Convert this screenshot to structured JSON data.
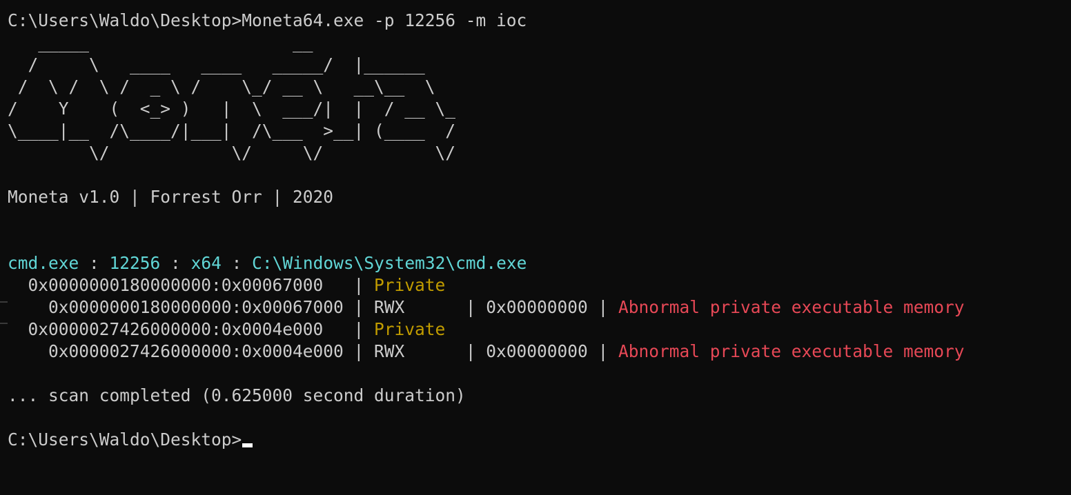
{
  "colors": {
    "background": "#0c0c0c",
    "default_text": "#cccccc",
    "cyan": "#61d6d6",
    "yellow": "#c19c00",
    "red": "#e74856",
    "cursor": "#ffffff"
  },
  "terminal": {
    "lines": [
      {
        "type": "command",
        "segments": [
          {
            "text": "C:\\Users\\Waldo\\Desktop>Moneta64.exe -p 12256 -m ioc",
            "color": "default"
          }
        ]
      },
      {
        "type": "banner",
        "segments": [
          {
            "text": "   _____                    __",
            "color": "default"
          }
        ]
      },
      {
        "type": "banner",
        "segments": [
          {
            "text": "  /     \\   ____   ____   _____/  |______",
            "color": "default"
          }
        ]
      },
      {
        "type": "banner",
        "segments": [
          {
            "text": " /  \\ /  \\ /  _ \\ /    \\_/ __ \\   __\\__  \\",
            "color": "default"
          }
        ]
      },
      {
        "type": "banner",
        "segments": [
          {
            "text": "/    Y    (  <_> )   |  \\  ___/|  |  / __ \\_",
            "color": "default"
          }
        ]
      },
      {
        "type": "banner",
        "segments": [
          {
            "text": "\\____|__  /\\____/|___|  /\\___  >__| (____  /",
            "color": "default"
          }
        ]
      },
      {
        "type": "banner",
        "segments": [
          {
            "text": "        \\/            \\/     \\/           \\/",
            "color": "default"
          }
        ]
      },
      {
        "type": "blank",
        "segments": []
      },
      {
        "type": "version",
        "segments": [
          {
            "text": "Moneta v1.0 | Forrest Orr | 2020",
            "color": "default"
          }
        ]
      },
      {
        "type": "blank",
        "segments": []
      },
      {
        "type": "blank",
        "segments": []
      },
      {
        "type": "process-header",
        "segments": [
          {
            "text": "cmd.exe",
            "color": "cyan"
          },
          {
            "text": " : ",
            "color": "default"
          },
          {
            "text": "12256",
            "color": "cyan"
          },
          {
            "text": " : ",
            "color": "default"
          },
          {
            "text": "x64",
            "color": "cyan"
          },
          {
            "text": " : ",
            "color": "default"
          },
          {
            "text": "C:\\Windows\\System32\\cmd.exe",
            "color": "cyan"
          }
        ]
      },
      {
        "type": "region",
        "segments": [
          {
            "text": "  0x0000000180000000:0x00067000   | ",
            "color": "default"
          },
          {
            "text": "Private",
            "color": "yellow"
          }
        ]
      },
      {
        "type": "subregion",
        "segments": [
          {
            "text": "    0x0000000180000000:0x00067000 | RWX      | 0x00000000 | ",
            "color": "default"
          },
          {
            "text": "Abnormal private executable memory",
            "color": "red"
          }
        ]
      },
      {
        "type": "region",
        "segments": [
          {
            "text": "  0x0000027426000000:0x0004e000   | ",
            "color": "default"
          },
          {
            "text": "Private",
            "color": "yellow"
          }
        ]
      },
      {
        "type": "subregion",
        "segments": [
          {
            "text": "    0x0000027426000000:0x0004e000 | RWX      | 0x00000000 | ",
            "color": "default"
          },
          {
            "text": "Abnormal private executable memory",
            "color": "red"
          }
        ]
      },
      {
        "type": "blank",
        "segments": []
      },
      {
        "type": "status",
        "segments": [
          {
            "text": "... scan completed (0.625000 second duration)",
            "color": "default"
          }
        ]
      },
      {
        "type": "blank",
        "segments": []
      },
      {
        "type": "prompt",
        "segments": [
          {
            "text": "C:\\Users\\Waldo\\Desktop>",
            "color": "default"
          }
        ],
        "cursor": true
      }
    ]
  }
}
